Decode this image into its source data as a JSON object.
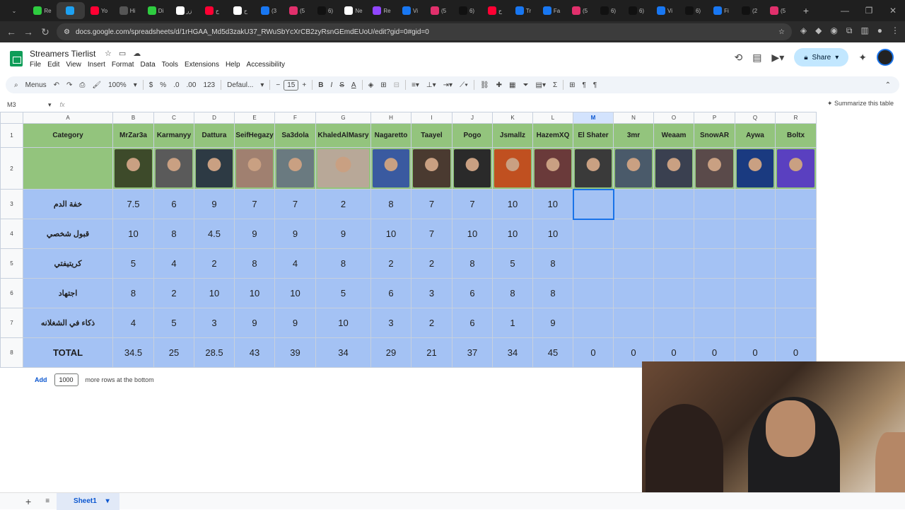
{
  "browser": {
    "tabs": [
      "Re",
      "",
      "Yo",
      "Hi",
      "Di",
      "زر",
      "ح",
      "ح",
      "(3",
      "(5",
      "6)",
      "Ne",
      "Re",
      "Vi",
      "(5",
      "6)",
      "ح",
      "Tr",
      "Fa",
      "(5",
      "6)",
      "6)",
      "Vi",
      "6)",
      "Fi",
      "(2",
      "(5"
    ],
    "url": "docs.google.com/spreadsheets/d/1rHGAA_Md5d3zakU37_RWuSbYcXrCB2zyRsnGEmdEUoU/edit?gid=0#gid=0"
  },
  "doc": {
    "title": "Streamers Tierlist",
    "menus": [
      "File",
      "Edit",
      "View",
      "Insert",
      "Format",
      "Data",
      "Tools",
      "Extensions",
      "Help",
      "Accessibility"
    ],
    "share_label": "Share"
  },
  "toolbar": {
    "menus_label": "Menus",
    "zoom": "100%",
    "currency": "$",
    "percent": "%",
    "dec_dec": ".0",
    "dec_inc": ".00",
    "numfmt": "123",
    "font": "Defaul...",
    "font_size": "15"
  },
  "formula_bar": {
    "cell_ref": "M3",
    "fx": "fx",
    "summarize": "Summarize this table"
  },
  "sheet": {
    "columns": [
      "A",
      "B",
      "C",
      "D",
      "E",
      "F",
      "G",
      "H",
      "I",
      "J",
      "K",
      "L",
      "M",
      "N",
      "O",
      "P",
      "Q",
      "R"
    ],
    "header_label": "Category",
    "streamers": [
      "MrZar3a",
      "Karmanyy",
      "Dattura",
      "SeifHegazy",
      "Sa3dola",
      "KhaledAlMasry",
      "Nagaretto",
      "Taayel",
      "Pogo",
      "Jsmallz",
      "HazemXQ",
      "El Shater",
      "3mr",
      "Weaam",
      "SnowAR",
      "Aywa",
      "Boltx"
    ],
    "rows": [
      {
        "category": "خفة الدم",
        "values": [
          "7.5",
          "6",
          "9",
          "7",
          "7",
          "2",
          "8",
          "7",
          "7",
          "10",
          "10",
          "",
          "",
          "",
          "",
          "",
          ""
        ]
      },
      {
        "category": "قبول شخصي",
        "values": [
          "10",
          "8",
          "4.5",
          "9",
          "9",
          "9",
          "10",
          "7",
          "10",
          "10",
          "10",
          "",
          "",
          "",
          "",
          "",
          ""
        ]
      },
      {
        "category": "كريتيفتي",
        "values": [
          "5",
          "4",
          "2",
          "8",
          "4",
          "8",
          "2",
          "2",
          "8",
          "5",
          "8",
          "",
          "",
          "",
          "",
          "",
          ""
        ]
      },
      {
        "category": "اجتهاد",
        "values": [
          "8",
          "2",
          "10",
          "10",
          "10",
          "5",
          "6",
          "3",
          "6",
          "8",
          "8",
          "",
          "",
          "",
          "",
          "",
          ""
        ]
      },
      {
        "category": "ذكاء في الشغلانه",
        "values": [
          "4",
          "5",
          "3",
          "9",
          "9",
          "10",
          "3",
          "2",
          "6",
          "1",
          "9",
          "",
          "",
          "",
          "",
          "",
          ""
        ]
      }
    ],
    "total_label": "TOTAL",
    "totals": [
      "34.5",
      "25",
      "28.5",
      "43",
      "39",
      "34",
      "29",
      "21",
      "37",
      "34",
      "45",
      "0",
      "0",
      "0",
      "0",
      "0",
      "0"
    ],
    "photo_colors": [
      "#3d4a2a",
      "#5a5a5a",
      "#2d3a44",
      "#a08070",
      "#6a7a80",
      "#b8a898",
      "#3a5aa0",
      "#4a3a30",
      "#2a2a2a",
      "#c05020",
      "#6a3a3a",
      "#3a3a3a",
      "#4a5a6a",
      "#3a4050",
      "#5a4a4a",
      "#1a3a80",
      "#5a40c0"
    ]
  },
  "footer": {
    "add_label": "Add",
    "rows_count": "1000",
    "rows_suffix": "more rows at the bottom",
    "sheet_name": "Sheet1"
  }
}
